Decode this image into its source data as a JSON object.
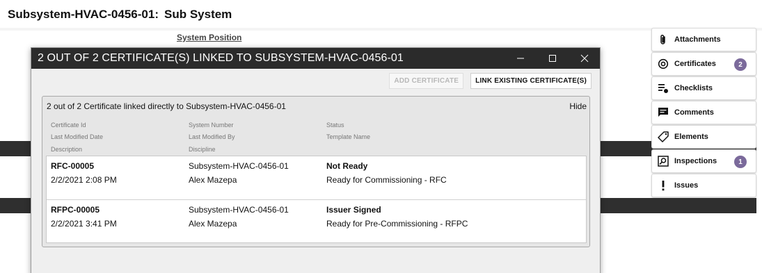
{
  "page": {
    "title_id": "Subsystem-HVAC-0456-01:",
    "title_type": "Sub System",
    "bg_link": "System Position"
  },
  "side_panel": {
    "items": [
      {
        "label": "Attachments",
        "icon": "paperclip-icon",
        "badge": ""
      },
      {
        "label": "Certificates",
        "icon": "certificate-icon",
        "badge": "2"
      },
      {
        "label": "Checklists",
        "icon": "checklist-icon",
        "badge": ""
      },
      {
        "label": "Comments",
        "icon": "comment-icon",
        "badge": ""
      },
      {
        "label": "Elements",
        "icon": "tag-icon",
        "badge": ""
      },
      {
        "label": "Inspections",
        "icon": "inspection-icon",
        "badge": "1"
      },
      {
        "label": "Issues",
        "icon": "exclamation-icon",
        "badge": ""
      }
    ],
    "badge_color": "#7b6a9b"
  },
  "modal": {
    "title": "2 OUT OF 2 CERTIFICATE(S) LINKED TO SUBSYSTEM-HVAC-0456-01",
    "add_button": "ADD CERTIFICATE",
    "link_button": "LINK EXISTING CERTIFICATE(S)",
    "group_title": "2 out of 2 Certificate linked directly to Subsystem-HVAC-0456-01",
    "hide_label": "Hide",
    "columns": {
      "c1": [
        "Certificate Id",
        "Last Modified Date",
        "Description"
      ],
      "c2": [
        "System Number",
        "Last Modified By",
        "Discipline"
      ],
      "c3": [
        "Status",
        "Template Name"
      ]
    },
    "certificates": [
      {
        "id": "RFC-00005",
        "date": "2/2/2021 2:08 PM",
        "system": "Subsystem-HVAC-0456-01",
        "modified_by": "Alex Mazepa",
        "status": "Not Ready",
        "template": "Ready for Commissioning - RFC"
      },
      {
        "id": "RFPC-00005",
        "date": "2/2/2021 3:41 PM",
        "system": "Subsystem-HVAC-0456-01",
        "modified_by": "Alex Mazepa",
        "status": "Issuer Signed",
        "template": "Ready for Pre-Commissioning - RFPC"
      }
    ]
  },
  "colors": {
    "titlebar": "#2b2b2b",
    "modal_bg": "#efefef",
    "group_bg": "#e6e6e6"
  }
}
